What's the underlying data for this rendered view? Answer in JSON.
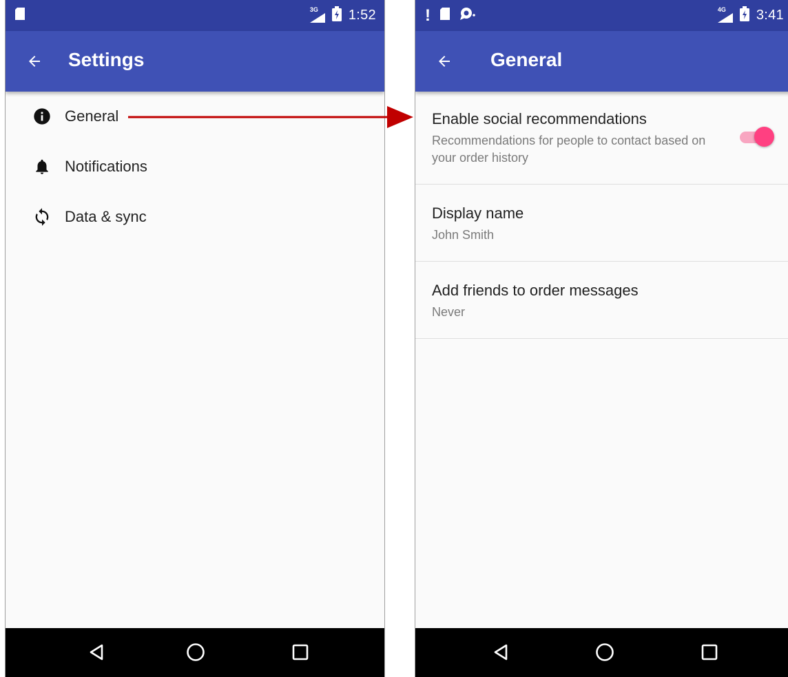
{
  "left_screen": {
    "status_bar": {
      "network": "3G",
      "time": "1:52"
    },
    "app_bar": {
      "title": "Settings"
    },
    "menu": [
      {
        "label": "General",
        "icon": "info-icon"
      },
      {
        "label": "Notifications",
        "icon": "bell-icon"
      },
      {
        "label": "Data & sync",
        "icon": "sync-icon"
      }
    ]
  },
  "right_screen": {
    "status_bar": {
      "network": "4G",
      "time": "3:41"
    },
    "app_bar": {
      "title": "General"
    },
    "preferences": [
      {
        "title": "Enable social recommendations",
        "summary": "Recommendations for people to contact based on your order history",
        "switch_on": true
      },
      {
        "title": "Display name",
        "summary": "John Smith"
      },
      {
        "title": "Add friends to order messages",
        "summary": "Never"
      }
    ]
  },
  "colors": {
    "status_bar": "#303f9f",
    "app_bar": "#3f51b5",
    "accent": "#ff4081",
    "arrow": "#c00000"
  }
}
